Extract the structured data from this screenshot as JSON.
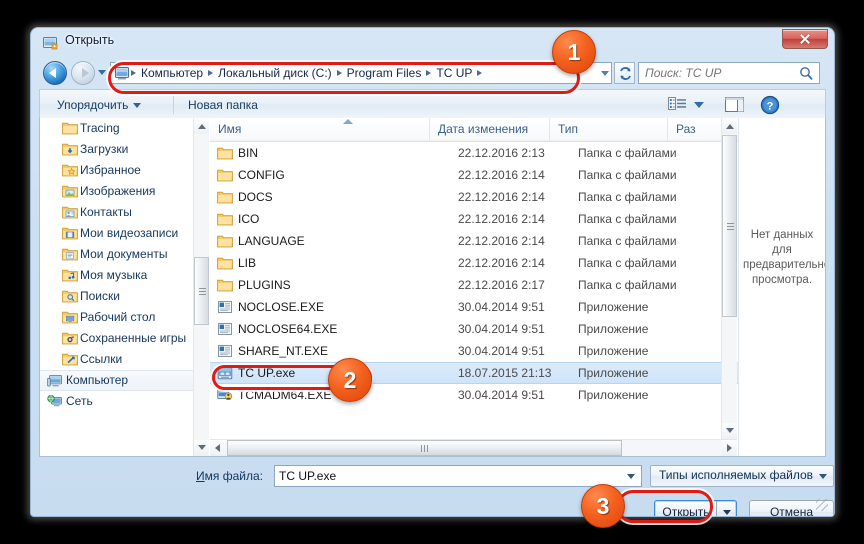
{
  "window": {
    "title": "Открыть",
    "icon": "open-folder-icon",
    "close_button": "close-icon"
  },
  "navigation": {
    "back_tooltip": "Назад",
    "forward_tooltip": "Вперед",
    "recent_caret": "chevron-down-icon",
    "breadcrumbs": [
      "Компьютер",
      "Локальный диск (C:)",
      "Program Files",
      "TC UP"
    ],
    "refresh_icon": "refresh-icon"
  },
  "search": {
    "placeholder": "Поиск: TC UP",
    "value": "",
    "icon": "search-icon"
  },
  "toolbar": {
    "organize_label": "Упорядочить",
    "new_folder_label": "Новая папка",
    "view_icon": "list-view-icon",
    "view_caret": "chevron-down-icon",
    "preview_pane_icon": "preview-pane-icon",
    "help_icon": "help-icon"
  },
  "sidebar": {
    "items": [
      {
        "label": "Tracing",
        "icon": "folder-icon",
        "indent": true,
        "selected": false
      },
      {
        "label": "Загрузки",
        "icon": "folder-download-icon",
        "indent": true,
        "selected": false
      },
      {
        "label": "Избранное",
        "icon": "folder-favorites-icon",
        "indent": true,
        "selected": false
      },
      {
        "label": "Изображения",
        "icon": "folder-pictures-icon",
        "indent": true,
        "selected": false
      },
      {
        "label": "Контакты",
        "icon": "folder-contacts-icon",
        "indent": true,
        "selected": false
      },
      {
        "label": "Мои видеозаписи",
        "icon": "folder-videos-icon",
        "indent": true,
        "selected": false
      },
      {
        "label": "Мои документы",
        "icon": "folder-documents-icon",
        "indent": true,
        "selected": false
      },
      {
        "label": "Моя музыка",
        "icon": "folder-music-icon",
        "indent": true,
        "selected": false
      },
      {
        "label": "Поиски",
        "icon": "folder-search-icon",
        "indent": true,
        "selected": false
      },
      {
        "label": "Рабочий стол",
        "icon": "folder-desktop-icon",
        "indent": true,
        "selected": false
      },
      {
        "label": "Сохраненные игры",
        "icon": "folder-savedgames-icon",
        "indent": true,
        "selected": false
      },
      {
        "label": "Ссылки",
        "icon": "folder-links-icon",
        "indent": true,
        "selected": false
      },
      {
        "label": "Компьютер",
        "icon": "computer-icon",
        "indent": false,
        "selected": true
      },
      {
        "label": "Сеть",
        "icon": "network-icon",
        "indent": false,
        "selected": false
      }
    ]
  },
  "filelist": {
    "columns": [
      "Имя",
      "Дата изменения",
      "Тип",
      "Раз"
    ],
    "sort_column": "Имя",
    "sort_direction": "ascending",
    "rows": [
      {
        "name": "BIN",
        "date": "22.12.2016 2:13",
        "type": "Папка с файлами",
        "icon": "folder-icon",
        "selected": false
      },
      {
        "name": "CONFIG",
        "date": "22.12.2016 2:14",
        "type": "Папка с файлами",
        "icon": "folder-icon",
        "selected": false
      },
      {
        "name": "DOCS",
        "date": "22.12.2016 2:14",
        "type": "Папка с файлами",
        "icon": "folder-icon",
        "selected": false
      },
      {
        "name": "ICO",
        "date": "22.12.2016 2:14",
        "type": "Папка с файлами",
        "icon": "folder-icon",
        "selected": false
      },
      {
        "name": "LANGUAGE",
        "date": "22.12.2016 2:14",
        "type": "Папка с файлами",
        "icon": "folder-icon",
        "selected": false
      },
      {
        "name": "LIB",
        "date": "22.12.2016 2:14",
        "type": "Папка с файлами",
        "icon": "folder-icon",
        "selected": false
      },
      {
        "name": "PLUGINS",
        "date": "22.12.2016 2:17",
        "type": "Папка с файлами",
        "icon": "folder-icon",
        "selected": false
      },
      {
        "name": "NOCLOSE.EXE",
        "date": "30.04.2014 9:51",
        "type": "Приложение",
        "icon": "exe-icon",
        "selected": false
      },
      {
        "name": "NOCLOSE64.EXE",
        "date": "30.04.2014 9:51",
        "type": "Приложение",
        "icon": "exe-icon",
        "selected": false
      },
      {
        "name": "SHARE_NT.EXE",
        "date": "30.04.2014 9:51",
        "type": "Приложение",
        "icon": "exe-icon",
        "selected": false
      },
      {
        "name": "TC UP.exe",
        "date": "18.07.2015 21:13",
        "type": "Приложение",
        "icon": "tcup-icon",
        "selected": true
      },
      {
        "name": "TCMADM64.EXE",
        "date": "30.04.2014 9:51",
        "type": "Приложение",
        "icon": "tcadmin-icon",
        "selected": false
      }
    ]
  },
  "preview": {
    "message": "Нет данных для предварительного просмотра."
  },
  "bottom": {
    "filename_label_underlined": "И",
    "filename_label_rest": "мя файла:",
    "filename_value": "TC UP.exe",
    "filetype_value": "Типы исполняемых файлов",
    "open_button_underlined": "О",
    "open_button_rest": "ткрыть",
    "cancel_button": "Отмена"
  },
  "annotations": {
    "callouts": [
      {
        "number": "1",
        "target": "address-bar"
      },
      {
        "number": "2",
        "target": "selected-file-row"
      },
      {
        "number": "3",
        "target": "open-button"
      }
    ],
    "accent_color": "#e01b15",
    "callout_color": "#f4611f"
  }
}
